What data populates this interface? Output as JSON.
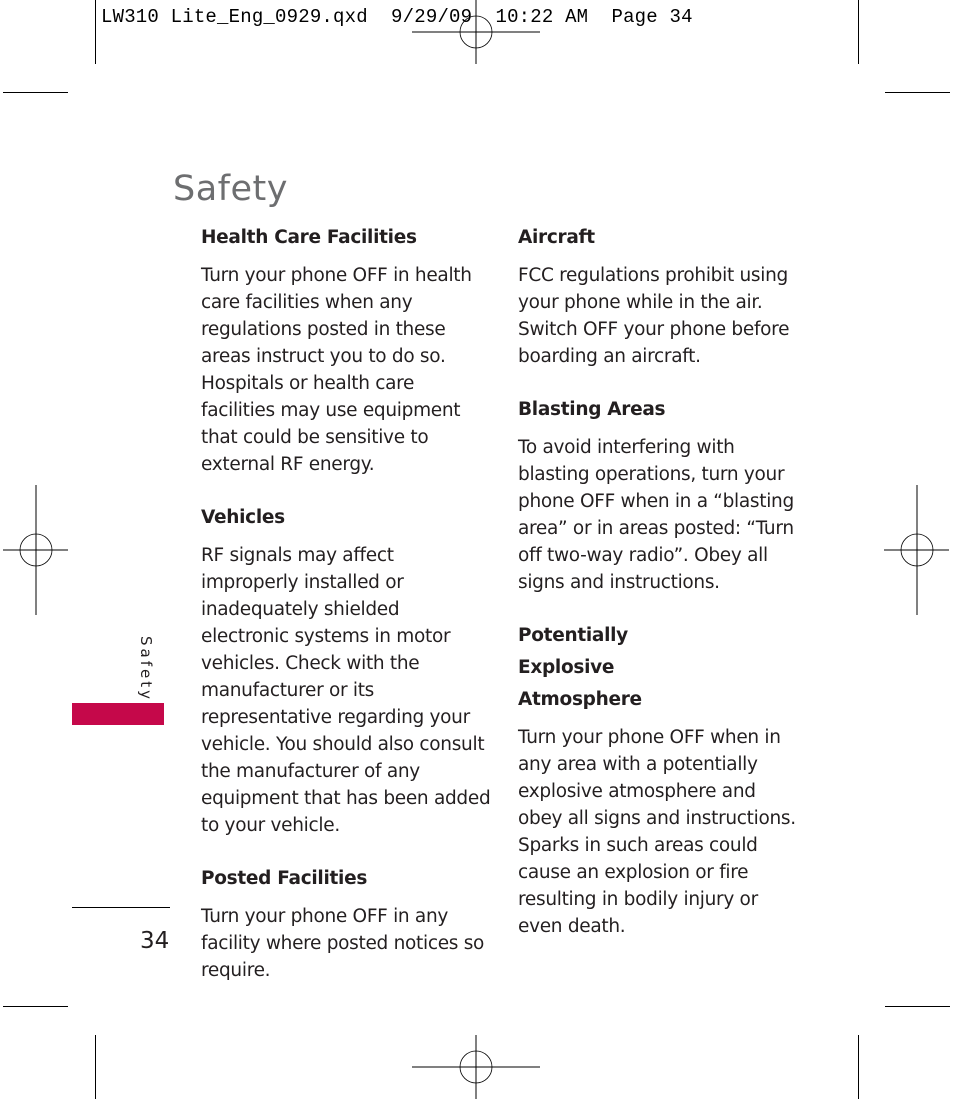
{
  "slug_line": "LW310 Lite_Eng_0929.qxd  9/29/09  10:22 AM  Page 34",
  "page_title": "Safety",
  "side_tab": {
    "label": "Safety",
    "color": "#c5084a"
  },
  "folio": "34",
  "left_column": [
    {
      "heading": "Health Care Facilities",
      "body": "Turn your phone OFF in health care facilities when any regulations posted in these areas instruct you to do so. Hospitals or health care facilities may use equipment that could be sensitive to external RF energy."
    },
    {
      "heading": "Vehicles",
      "body": "RF signals may affect improperly installed or inadequately shielded electronic systems in motor vehicles. Check with the manufacturer or its representative regarding your vehicle. You should also consult the manufacturer of any equipment that has been added to your vehicle."
    },
    {
      "heading": "Posted Facilities",
      "body": "Turn your phone OFF in any facility where posted notices so require."
    }
  ],
  "right_column": [
    {
      "heading": "Aircraft",
      "body": "FCC regulations prohibit using your phone while in the air. Switch OFF your phone before boarding an aircraft."
    },
    {
      "heading": "Blasting Areas",
      "body": "To avoid interfering with blasting operations, turn your phone OFF when in a “blasting area” or in areas posted: “Turn off two-way radio”. Obey all signs and instructions."
    },
    {
      "heading": "Potentially Explosive Atmosphere",
      "body": "Turn your phone OFF when in any area with a potentially explosive atmosphere and obey all signs and instructions. Sparks in such areas could cause an explosion or fire resulting in bodily injury or even death."
    }
  ]
}
